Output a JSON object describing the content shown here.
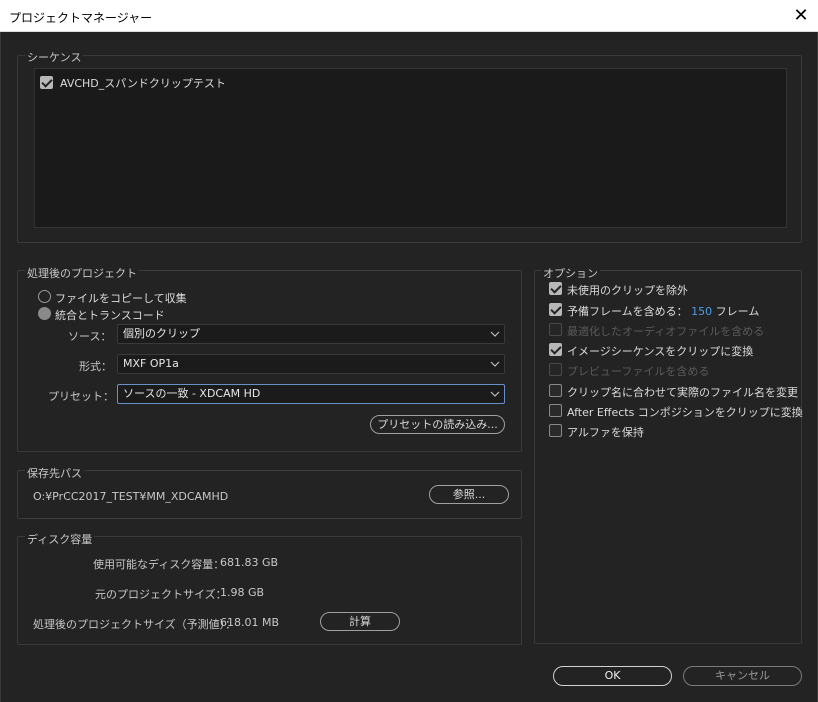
{
  "window": {
    "title": "プロジェクトマネージャー",
    "close_glyph": "✕"
  },
  "sequence": {
    "label": "シーケンス",
    "items": [
      {
        "label": "AVCHD_スパンドクリップテスト",
        "checked": true
      }
    ]
  },
  "processed_project": {
    "label": "処理後のプロジェクト",
    "radio_copy": "ファイルをコピーして収集",
    "radio_transcode": "統合とトランスコード",
    "source_label": "ソース：",
    "source_value": "個別のクリップ",
    "format_label": "形式：",
    "format_value": "MXF OP1a",
    "preset_label": "プリセット：",
    "preset_value": "ソースの一致 - XDCAM HD",
    "import_preset_button": "プリセットの読み込み..."
  },
  "destination": {
    "label": "保存先パス",
    "path": "O:¥PrCC2017_TEST¥MM_XDCAMHD",
    "browse_button": "参照..."
  },
  "disk": {
    "label": "ディスク容量",
    "available_label": "使用可能なディスク容量：",
    "available_value": "681.83 GB",
    "original_label": "元のプロジェクトサイズ：",
    "original_value": "1.98 GB",
    "estimated_label": "処理後のプロジェクトサイズ（予測値）：",
    "estimated_value": "618.01 MB",
    "calculate_button": "計算"
  },
  "options": {
    "label": "オプション",
    "exclude_unused": "未使用のクリップを除外",
    "handles_prefix": "予備フレームを含める：",
    "handles_value": "150",
    "handles_suffix": "フレーム",
    "optimized_audio": "最適化したオーディオファイルを含める",
    "convert_image_sequences": "イメージシーケンスをクリップに変換",
    "preview_files": "プレビューファイルを含める",
    "rename_media": "クリップ名に合わせて実際のファイル名を変更",
    "ae_compositions": "After Effects コンポジションをクリップに変換",
    "preserve_alpha": "アルファを保持"
  },
  "footer": {
    "ok_button": "OK",
    "cancel_button": "キャンセル"
  }
}
